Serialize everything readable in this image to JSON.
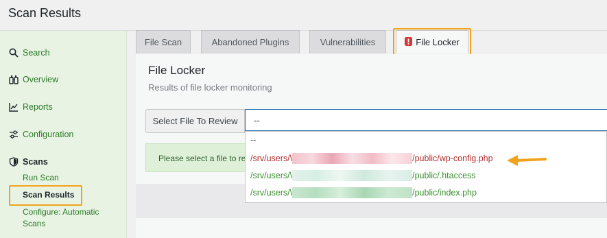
{
  "page": {
    "title": "Scan Results"
  },
  "sidebar": {
    "items": [
      {
        "label": "Search",
        "icon": "search-icon"
      },
      {
        "label": "Overview",
        "icon": "binoculars-icon"
      },
      {
        "label": "Reports",
        "icon": "chart-line-icon"
      },
      {
        "label": "Configuration",
        "icon": "sliders-icon"
      },
      {
        "label": "Scans",
        "icon": "shield-icon"
      }
    ],
    "sub_items": [
      {
        "label": "Run Scan"
      },
      {
        "label": "Scan Results"
      },
      {
        "label": "Configure: Automatic Scans"
      }
    ]
  },
  "tabs": [
    {
      "label": "File Scan"
    },
    {
      "label": "Abandoned Plugins"
    },
    {
      "label": "Vulnerabilities"
    },
    {
      "label": "File Locker",
      "icon": "alert-icon"
    }
  ],
  "main": {
    "title": "File Locker",
    "subtitle": "Results of file locker monitoring",
    "select_label": "Select File To Review",
    "select_value": "--",
    "notice": "Please select a file to review"
  },
  "dropdown": {
    "options": [
      {
        "prefix": "--",
        "suffix": ""
      },
      {
        "prefix": "/srv/users/\\",
        "suffix": "/public/wp-config.php",
        "status": "changed"
      },
      {
        "prefix": "/srv/users/\\",
        "suffix": "/public/.htaccess",
        "status": "ok"
      },
      {
        "prefix": "/srv/users/\\",
        "suffix": "/public/index.php",
        "status": "ok"
      }
    ]
  },
  "colors": {
    "accent": "#2c7a27",
    "highlight": "#f0a41d",
    "alert": "#d63638"
  }
}
